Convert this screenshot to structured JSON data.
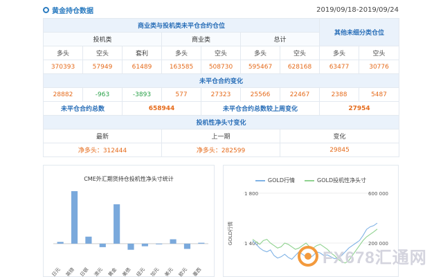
{
  "header": {
    "title": "黄金持仓数据",
    "date_range": "2019/09/18-2019/09/24"
  },
  "table": {
    "section1_title": "商业类与投机类未平仓合约仓位",
    "other_title": "其他未细分类仓位",
    "groups": [
      "投机类",
      "商业类",
      "总计"
    ],
    "cols": [
      "多头",
      "空头",
      "套利",
      "多头",
      "空头",
      "多头",
      "空头",
      "多头",
      "空头"
    ],
    "positions": [
      "370393",
      "57949",
      "61489",
      "163585",
      "508730",
      "595467",
      "628168",
      "63477",
      "30776"
    ],
    "section2_title": "未平仓合约变化",
    "changes": [
      "28882",
      "-963",
      "-3893",
      "577",
      "27323",
      "25566",
      "22467",
      "2388",
      "5487"
    ],
    "total_label": "未平仓合约总数",
    "total_value": "658944",
    "weekly_label": "未平仓合约总数较上周变化",
    "weekly_value": "27954",
    "section3_title": "投机性净头寸变化",
    "net_headers": [
      "最新",
      "上一期",
      "变化"
    ],
    "net_values": [
      "净多头：312444",
      "净多头：282599",
      "29845"
    ]
  },
  "chart_data": [
    {
      "type": "bar",
      "title": "CME外汇期货持仓投机性净头寸统计",
      "categories": [
        "日元",
        "英镑",
        "日银",
        "澳元",
        "黄金",
        "美债",
        "纽元",
        "加元",
        "美元",
        "欧元",
        "墨西"
      ],
      "values": [
        2,
        60,
        8,
        -4,
        45,
        -7,
        -3,
        0,
        5,
        -6,
        1
      ],
      "ylim": [
        -12,
        64
      ],
      "color": "#7aa9dc"
    },
    {
      "type": "line",
      "series": [
        {
          "name": "GOLD行情",
          "color": "#7fb2e5",
          "values": [
            1420,
            1390,
            1360,
            1340,
            1330,
            1345,
            1300,
            1280,
            1290,
            1310,
            1285,
            1270,
            1300,
            1330,
            1310,
            1290,
            1280,
            1300,
            1330,
            1320,
            1300,
            1305,
            1290,
            1275,
            1280,
            1300,
            1330,
            1360,
            1380,
            1400,
            1420,
            1460,
            1510,
            1530,
            1540,
            1560
          ]
        },
        {
          "name": "GOLD投机性净头寸",
          "color": "#8fd28f",
          "values": [
            230000,
            210000,
            190000,
            220000,
            230000,
            200000,
            180000,
            160000,
            170000,
            200000,
            190000,
            170000,
            150000,
            160000,
            180000,
            200000,
            170000,
            160000,
            180000,
            190000,
            170000,
            150000,
            120000,
            100000,
            70000,
            50000,
            40000,
            60000,
            100000,
            140000,
            180000,
            220000,
            250000,
            270000,
            290000,
            312444
          ]
        }
      ],
      "y_left": {
        "label": "GOLD行情",
        "ticks": [
          "1 800",
          "1 400"
        ]
      },
      "y_right": {
        "ticks": [
          "600 000",
          "200 000"
        ]
      }
    }
  ],
  "watermark": {
    "text": "FX678汇通网"
  }
}
